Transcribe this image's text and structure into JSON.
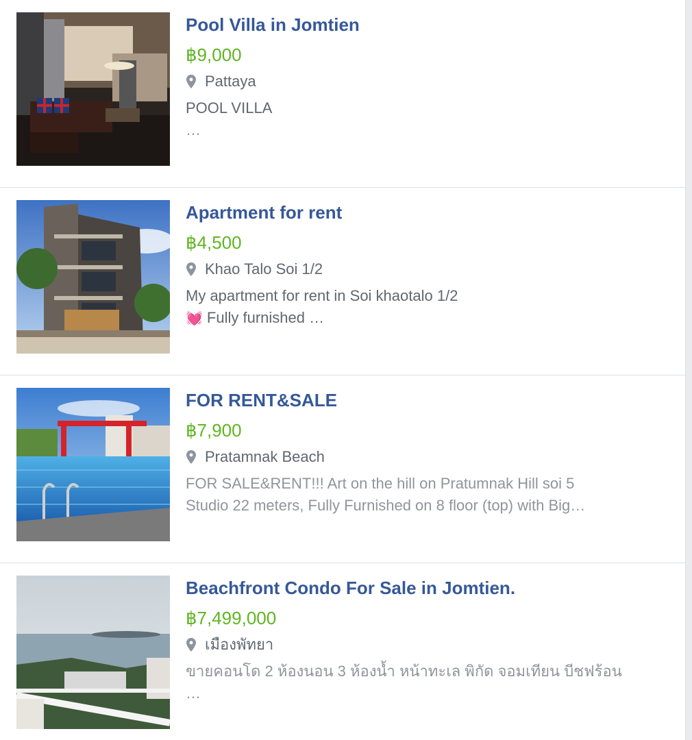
{
  "listings": [
    {
      "title": "Pool Villa in Jomtien",
      "price": "฿9,000",
      "location": "Pattaya",
      "desc_line1": "POOL VILLA",
      "desc_line2": "…",
      "thumb_icon": "living-room-photo"
    },
    {
      "title": "Apartment for rent",
      "price": "฿4,500",
      "location": "Khao Talo Soi 1/2",
      "desc_line1": "My apartment for rent in Soi khaotalo 1/2",
      "desc_line2_emoji": "💓",
      "desc_line2": "Fully furnished …",
      "thumb_icon": "apartment-building-photo"
    },
    {
      "title": "FOR RENT&SALE",
      "price": "฿7,900",
      "location": "Pratamnak Beach",
      "desc_line1": "FOR SALE&RENT!!! Art on the hill on Pratumnak Hill soi 5",
      "desc_line2": "Studio 22 meters, Fully Furnished on 8 floor (top) with Big…",
      "thumb_icon": "rooftop-pool-photo"
    },
    {
      "title": "Beachfront Condo For Sale in Jomtien.",
      "price": "฿7,499,000",
      "location": "เมืองพัทยา",
      "desc_line1": "ขายคอนโด 2 ห้องนอน 3 ห้องน้ำ หน้าทะเล พิกัด จอมเทียน บีชฟร้อน",
      "desc_line2": "…",
      "thumb_icon": "sea-view-balcony-photo"
    }
  ],
  "colors": {
    "title": "#365899",
    "price": "#5fb522",
    "location": "#606770",
    "description": "#90949c",
    "pin": "#8d949e"
  }
}
